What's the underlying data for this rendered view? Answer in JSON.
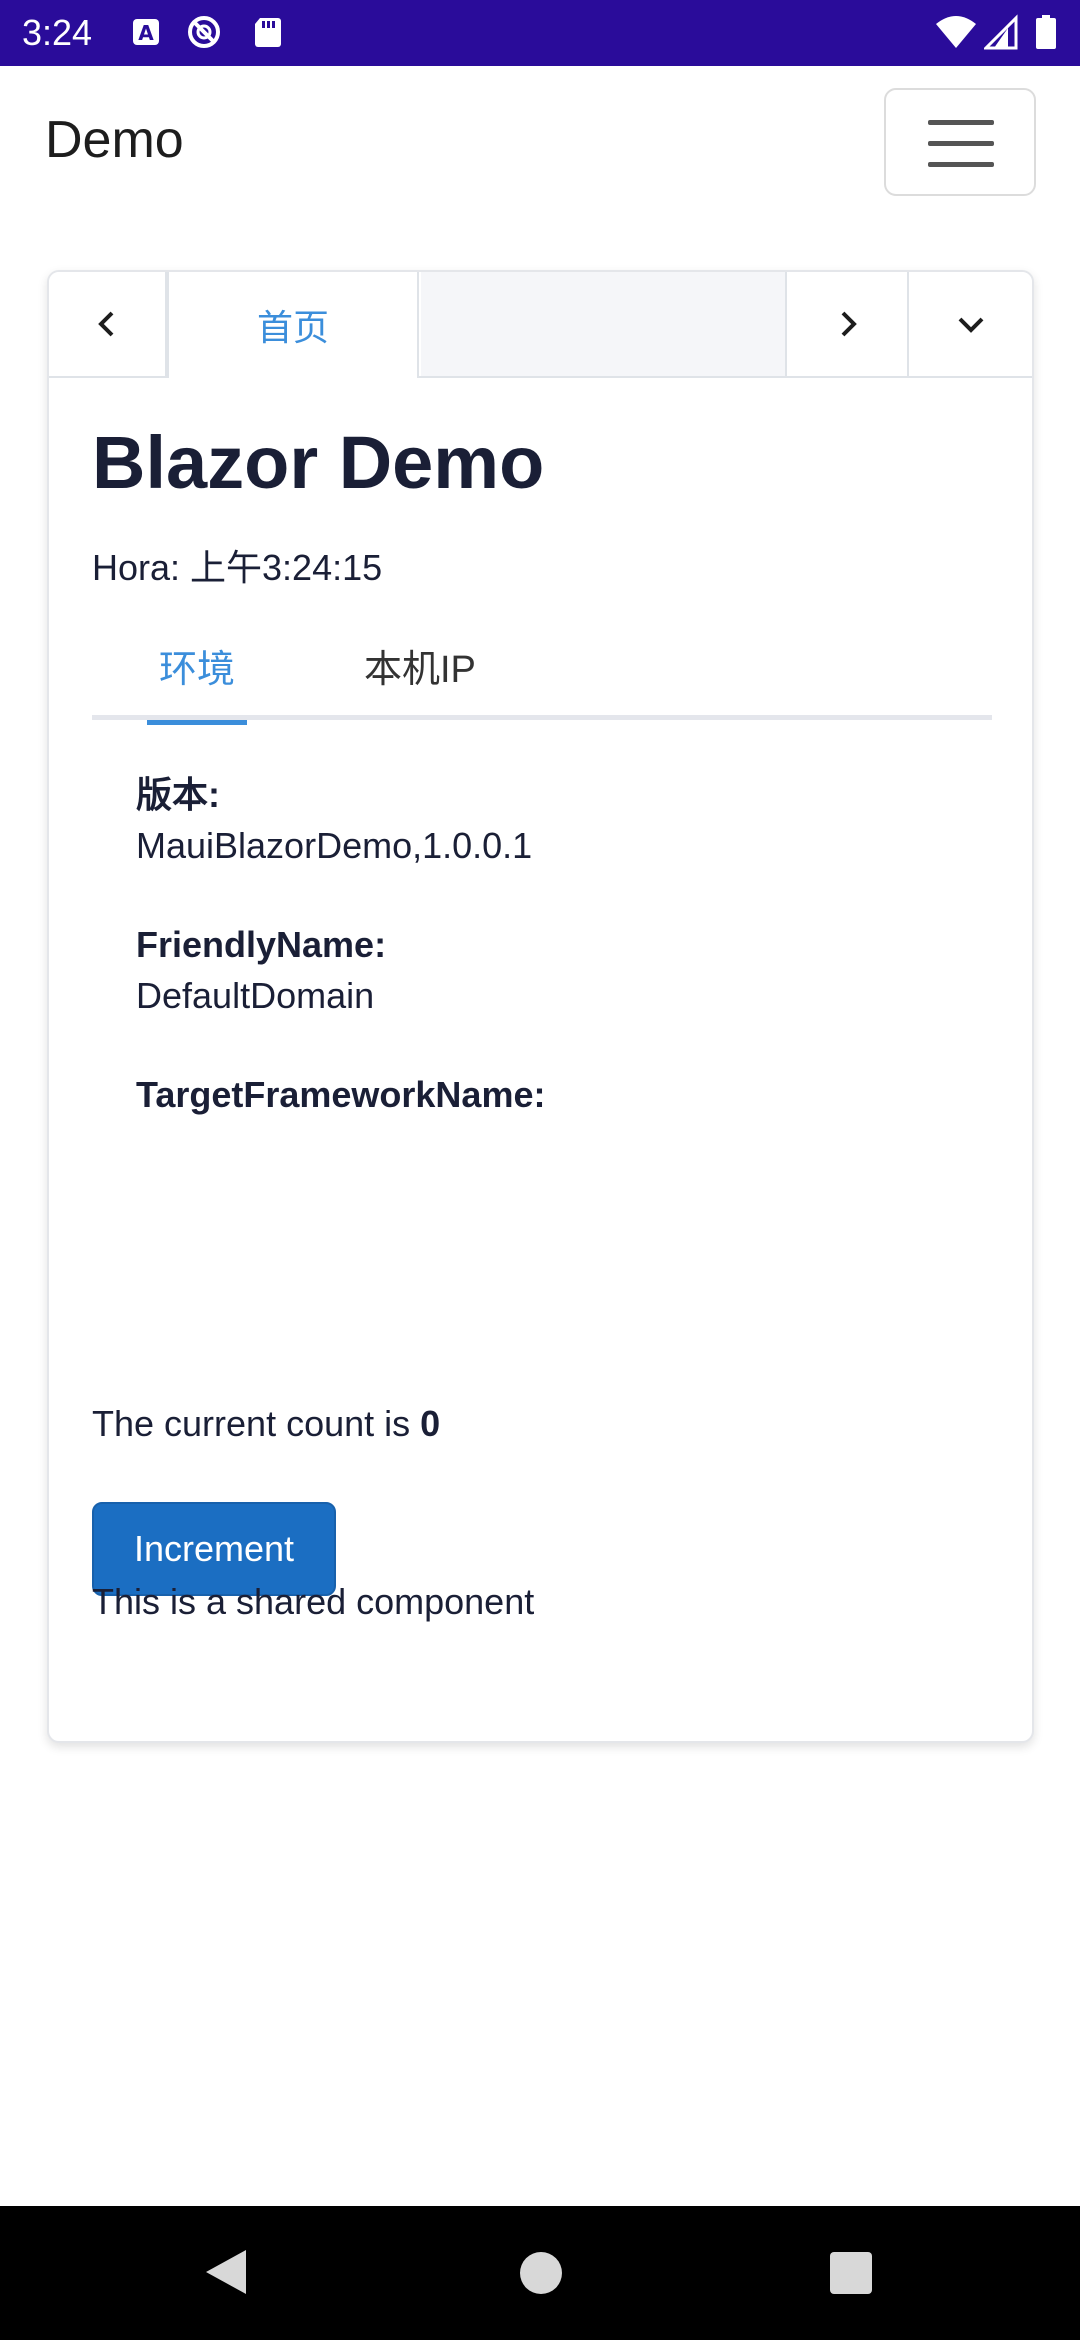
{
  "status_bar": {
    "time": "3:24",
    "left_icons": [
      "font-notification-icon",
      "sync-blocked-icon",
      "sd-card-icon"
    ],
    "right_icons": [
      "wifi-icon",
      "cell-signal-icon",
      "battery-icon"
    ],
    "background": "#2a0c9a"
  },
  "header": {
    "brand": "Demo",
    "menu_icon": "hamburger-menu-icon"
  },
  "tab_bar": {
    "prev_icon": "chevron-left-icon",
    "tabs": [
      {
        "label": "首页",
        "active": true
      }
    ],
    "next_icon": "chevron-right-icon",
    "dropdown_icon": "chevron-down-icon"
  },
  "page": {
    "title": "Blazor Demo",
    "time_label": "Hora: 上午3:24:15"
  },
  "inner_tabs": [
    {
      "label": "环境",
      "active": true
    },
    {
      "label": "本机IP",
      "active": false
    }
  ],
  "environment": [
    {
      "label": "版本:",
      "value": "MauiBlazorDemo,1.0.0.1"
    },
    {
      "label": "FriendlyName:",
      "value": "DefaultDomain"
    },
    {
      "label": "TargetFrameworkName:",
      "value": ""
    }
  ],
  "counter": {
    "prefix": "The current count is ",
    "count": "0",
    "button_label": "Increment",
    "shared_text": "This is a shared component"
  },
  "colors": {
    "accent": "#3b8edb",
    "primary_button": "#1b6ec2",
    "text": "#1a1f36"
  },
  "nav_bar": {
    "icons": [
      "back-triangle-icon",
      "home-circle-icon",
      "recents-square-icon"
    ]
  }
}
